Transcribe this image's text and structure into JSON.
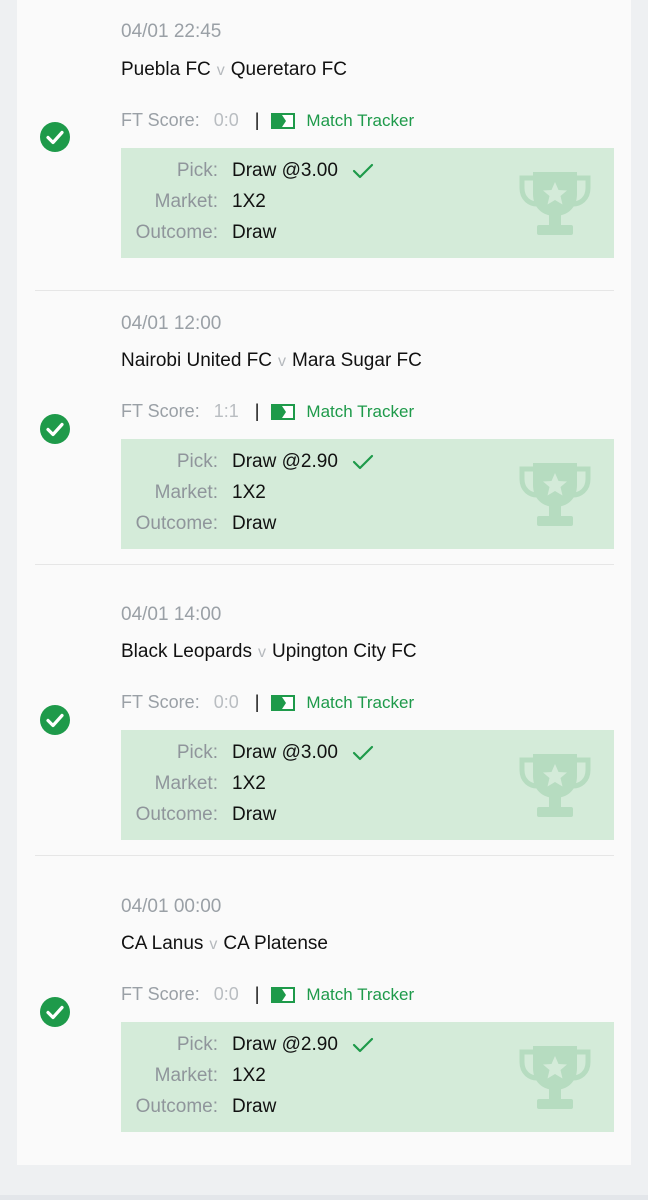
{
  "colors": {
    "accent_green": "#1e9a4a",
    "box_green": "#d4ebd9",
    "muted_gray": "#9aa0a6"
  },
  "labels": {
    "ft_score": "FT Score:",
    "match_tracker": "Match Tracker",
    "pick": "Pick:",
    "market": "Market:",
    "outcome": "Outcome:",
    "versus": "v",
    "divider": "|"
  },
  "bets": [
    {
      "datetime": "04/01 22:45",
      "home": "Puebla FC",
      "away": "Queretaro FC",
      "ft_score": "0:0",
      "pick": "Draw @3.00",
      "market": "1X2",
      "outcome": "Draw",
      "status_icon": "check-circle-icon"
    },
    {
      "datetime": "04/01 12:00",
      "home": "Nairobi United FC",
      "away": "Mara Sugar FC",
      "ft_score": "1:1",
      "pick": "Draw @2.90",
      "market": "1X2",
      "outcome": "Draw",
      "status_icon": "check-circle-icon"
    },
    {
      "datetime": "04/01 14:00",
      "home": "Black Leopards",
      "away": "Upington City FC",
      "ft_score": "0:0",
      "pick": "Draw @3.00",
      "market": "1X2",
      "outcome": "Draw",
      "status_icon": "check-circle-icon"
    },
    {
      "datetime": "04/01 00:00",
      "home": "CA Lanus",
      "away": "CA Platense",
      "ft_score": "0:0",
      "pick": "Draw @2.90",
      "market": "1X2",
      "outcome": "Draw",
      "status_icon": "check-circle-icon"
    }
  ]
}
